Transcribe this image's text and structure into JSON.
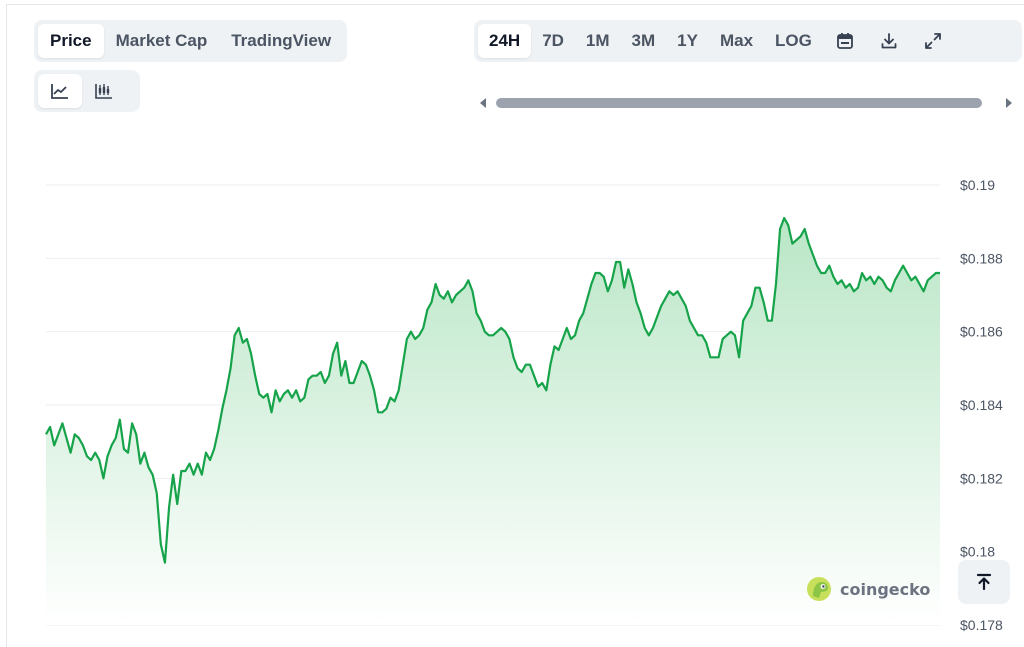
{
  "view_tabs": [
    {
      "label": "Price",
      "active": true
    },
    {
      "label": "Market Cap",
      "active": false
    },
    {
      "label": "TradingView",
      "active": false
    }
  ],
  "chart_types": [
    {
      "icon": "line-chart-icon",
      "active": true
    },
    {
      "icon": "candlestick-chart-icon",
      "active": false
    }
  ],
  "range_tabs": [
    {
      "label": "24H",
      "active": true
    },
    {
      "label": "7D",
      "active": false
    },
    {
      "label": "1M",
      "active": false
    },
    {
      "label": "3M",
      "active": false
    },
    {
      "label": "1Y",
      "active": false
    },
    {
      "label": "Max",
      "active": false
    },
    {
      "label": "LOG",
      "active": false
    }
  ],
  "tools": [
    "calendar-icon",
    "download-icon",
    "expand-icon"
  ],
  "brand": "coingecko",
  "colors": {
    "line": "#16a34a",
    "area_top": "#b9e6c6",
    "area_bottom": "#ffffff",
    "grid": "#eceef1"
  },
  "chart_data": {
    "type": "area",
    "title": "",
    "xlabel": "",
    "ylabel": "",
    "ylim": [
      0.178,
      0.19
    ],
    "yticks": [
      0.19,
      0.188,
      0.186,
      0.184,
      0.182,
      0.18,
      0.178
    ],
    "ytick_labels": [
      "$0.19",
      "$0.188",
      "$0.186",
      "$0.184",
      "$0.182",
      "$0.18",
      "$0.178"
    ],
    "grid": true,
    "series": [
      {
        "values": [
          0.1832,
          0.1834,
          0.1829,
          0.1832,
          0.1835,
          0.1831,
          0.1827,
          0.1832,
          0.1831,
          0.1829,
          0.1826,
          0.1825,
          0.1827,
          0.1825,
          0.182,
          0.1826,
          0.1829,
          0.1831,
          0.1836,
          0.1828,
          0.1827,
          0.1835,
          0.1832,
          0.1824,
          0.1827,
          0.1823,
          0.1821,
          0.1816,
          0.1802,
          0.1797,
          0.1812,
          0.1821,
          0.1813,
          0.1822,
          0.1822,
          0.1824,
          0.1821,
          0.1824,
          0.1821,
          0.1827,
          0.1825,
          0.1828,
          0.1833,
          0.1839,
          0.1844,
          0.185,
          0.1859,
          0.1861,
          0.1857,
          0.1858,
          0.1854,
          0.1848,
          0.1843,
          0.1842,
          0.1843,
          0.1838,
          0.1844,
          0.1841,
          0.1843,
          0.1844,
          0.1842,
          0.1844,
          0.1841,
          0.1842,
          0.1847,
          0.1848,
          0.1848,
          0.1849,
          0.1846,
          0.1848,
          0.1854,
          0.1857,
          0.1848,
          0.1852,
          0.1846,
          0.1846,
          0.1849,
          0.1852,
          0.1851,
          0.1848,
          0.1844,
          0.1838,
          0.1838,
          0.1839,
          0.1842,
          0.1841,
          0.1844,
          0.1851,
          0.1858,
          0.186,
          0.1858,
          0.1859,
          0.1861,
          0.1866,
          0.1868,
          0.1873,
          0.187,
          0.1869,
          0.1871,
          0.1868,
          0.187,
          0.1871,
          0.1872,
          0.1874,
          0.1871,
          0.1865,
          0.1863,
          0.186,
          0.1859,
          0.1859,
          0.186,
          0.1861,
          0.186,
          0.1858,
          0.1853,
          0.185,
          0.1849,
          0.1851,
          0.1851,
          0.1848,
          0.1845,
          0.1846,
          0.1844,
          0.1851,
          0.1856,
          0.1855,
          0.1858,
          0.1861,
          0.1858,
          0.1859,
          0.1863,
          0.1865,
          0.1869,
          0.1873,
          0.1876,
          0.1876,
          0.1875,
          0.1871,
          0.1874,
          0.1879,
          0.1879,
          0.1872,
          0.1877,
          0.1873,
          0.1868,
          0.1865,
          0.1861,
          0.1859,
          0.1861,
          0.1864,
          0.1867,
          0.1869,
          0.1871,
          0.187,
          0.1871,
          0.1869,
          0.1867,
          0.1863,
          0.1861,
          0.1859,
          0.1859,
          0.1857,
          0.1853,
          0.1853,
          0.1853,
          0.1858,
          0.1859,
          0.186,
          0.1859,
          0.1853,
          0.1863,
          0.1865,
          0.1867,
          0.1872,
          0.1872,
          0.1868,
          0.1863,
          0.1863,
          0.1873,
          0.1888,
          0.1891,
          0.1889,
          0.1884,
          0.1885,
          0.1886,
          0.1888,
          0.1884,
          0.1881,
          0.1878,
          0.1876,
          0.1876,
          0.1878,
          0.1875,
          0.1873,
          0.1874,
          0.1872,
          0.1873,
          0.1871,
          0.1872,
          0.1876,
          0.1874,
          0.1875,
          0.1873,
          0.1875,
          0.1874,
          0.1872,
          0.1871,
          0.1874,
          0.1876,
          0.1878,
          0.1876,
          0.1874,
          0.1875,
          0.1873,
          0.1871,
          0.1874,
          0.1875,
          0.1876,
          0.1876
        ]
      }
    ]
  }
}
